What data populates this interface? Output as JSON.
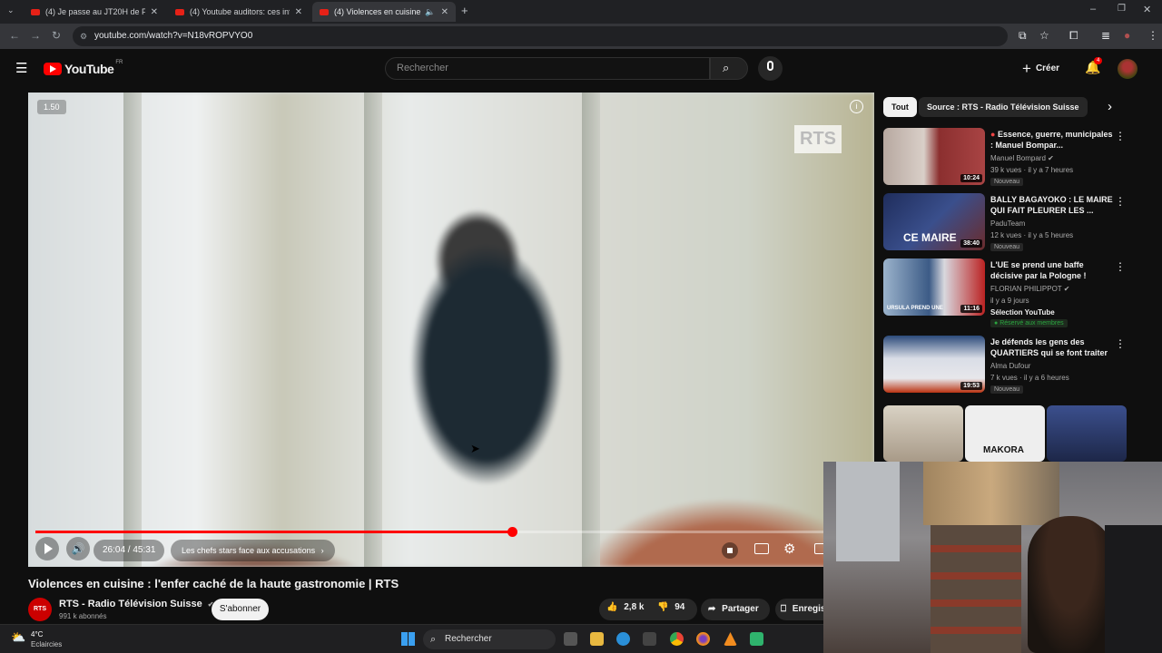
{
  "browser": {
    "tabs": [
      {
        "label": "(4) Je passe au JT20H de France"
      },
      {
        "label": "(4) Youtube auditors: ces influe"
      },
      {
        "label": "(4) Violences en cuisine : l'e"
      }
    ],
    "url": "youtube.com/watch?v=N18vROPVYO0"
  },
  "header": {
    "logo": "YouTube",
    "logo_region": "FR",
    "search_placeholder": "Rechercher",
    "create_label": "Créer",
    "notif_count": "4"
  },
  "player": {
    "speed": "1.50",
    "watermark": "RTS",
    "time": "26:04 / 45:31",
    "chapter": "Les chefs stars face aux accusations",
    "progress_fraction": 0.5727
  },
  "video": {
    "title": "Violences en cuisine : l'enfer caché de la haute gastronomie | RTS",
    "channel_avatar": "RTS",
    "channel": "RTS - Radio Télévision Suisse",
    "subscribers": "991 k abonnés",
    "subscribe_label": "S'abonner",
    "likes": "2,8 k",
    "dislikes": "94",
    "share_label": "Partager",
    "save_label": "Enregis"
  },
  "sidebar": {
    "chips": [
      {
        "label": "Tout"
      },
      {
        "label": "Source : RTS - Radio Télévision Suisse"
      }
    ],
    "recommendations": [
      {
        "title": "Essence, guerre, municipales : Manuel Bompar...",
        "channel": "Manuel Bompard",
        "meta": "39 k vues · il y a 7 heures",
        "badge": "Nouveau",
        "duration": "10:24",
        "thumb_color": "#8b2f2f"
      },
      {
        "title": "BALLY BAGAYOKO : LE MAIRE QUI FAIT PLEURER LES ...",
        "channel": "PaduTeam",
        "meta": "12 k vues · il y a 5 heures",
        "badge": "Nouveau",
        "duration": "38:40",
        "thumb_color": "#3a4f8c",
        "thumb_text": "CE MAIRE"
      },
      {
        "title": "L'UE se prend une baffe décisive par la Pologne !",
        "channel": "FLORIAN PHILIPPOT",
        "meta": "il y a 9 jours",
        "badge": "Sélection YouTube",
        "extra": "Réservé aux membres",
        "duration": "11:16",
        "thumb_color": "#3c5b86",
        "thumb_text": "URSULA PREND UNE"
      },
      {
        "title": "Je défends les gens des QUARTIERS qui se font traiter ...",
        "channel": "Alma Dufour",
        "meta": "7 k vues · il y a 6 heures",
        "badge": "Nouveau",
        "duration": "19:53",
        "thumb_color": "#2c4a7a"
      }
    ],
    "shorts_text": "MAKORA"
  },
  "taskbar": {
    "temperature": "4°C",
    "weather": "Eclaircies",
    "search": "Rechercher"
  }
}
